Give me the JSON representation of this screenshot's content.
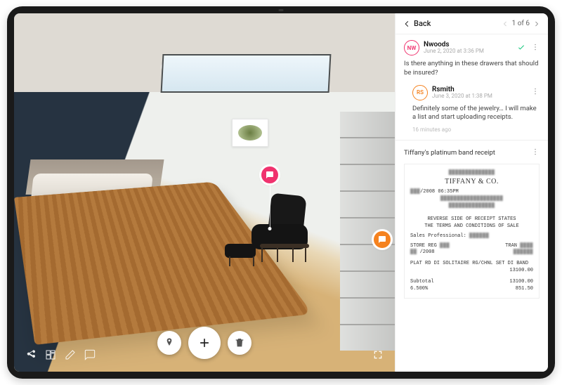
{
  "panel": {
    "back_label": "Back",
    "pager_text": "1 of 6"
  },
  "thread": {
    "author": {
      "initials": "NW",
      "name": "Nwoods",
      "timestamp": "June 2, 2020 at 3:36 PM"
    },
    "body": "Is there anything in these drawers that should be insured?",
    "reply": {
      "author": {
        "initials": "RS",
        "name": "Rsmith",
        "timestamp": "June 3, 2020 at 1:38 PM"
      },
      "body": "Definitely some of the jewelry… I will make a list and start uploading receipts.",
      "ago": "16 minutes ago"
    }
  },
  "attachment": {
    "title": "Tiffany's platinum band receipt",
    "brand": "TIFFANY & CO.",
    "date_line": "/2008 06:35PM",
    "notice1": "REVERSE SIDE OF RECEIPT STATES",
    "notice2": "THE TERMS AND CONDITIONS OF SALE",
    "sales_label": "Sales Professional:",
    "line1_l": "STORE   REG",
    "line1_r": "TRAN",
    "line2_l": "        /2008",
    "line2_r": "",
    "item": "PLAT RD DI SOLITAIRE RG/CHNL SET DI BAND",
    "item_price": "13100.00",
    "subtotal_label": "Subtotal",
    "subtotal_value": "13100.00",
    "tax_label": "6.500%",
    "tax_value": "851.50"
  },
  "colors": {
    "accent_pink": "#f0326e",
    "accent_orange": "#f5821f",
    "success": "#14c77c"
  }
}
